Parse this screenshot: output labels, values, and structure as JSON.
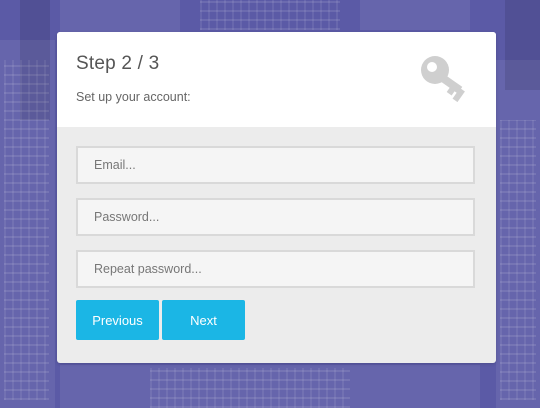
{
  "form": {
    "step_title": "Step 2 / 3",
    "step_subtitle": "Set up your account:",
    "fields": [
      {
        "placeholder": "Email...",
        "value": ""
      },
      {
        "placeholder": "Password...",
        "value": ""
      },
      {
        "placeholder": "Repeat password...",
        "value": ""
      }
    ],
    "previous_label": "Previous",
    "next_label": "Next"
  },
  "icons": {
    "header": "key-icon"
  },
  "colors": {
    "background": "#5b5aa6",
    "card_body": "#ececec",
    "card_header": "#ffffff",
    "button": "#1bb6e5",
    "icon": "#cfcfcf"
  }
}
